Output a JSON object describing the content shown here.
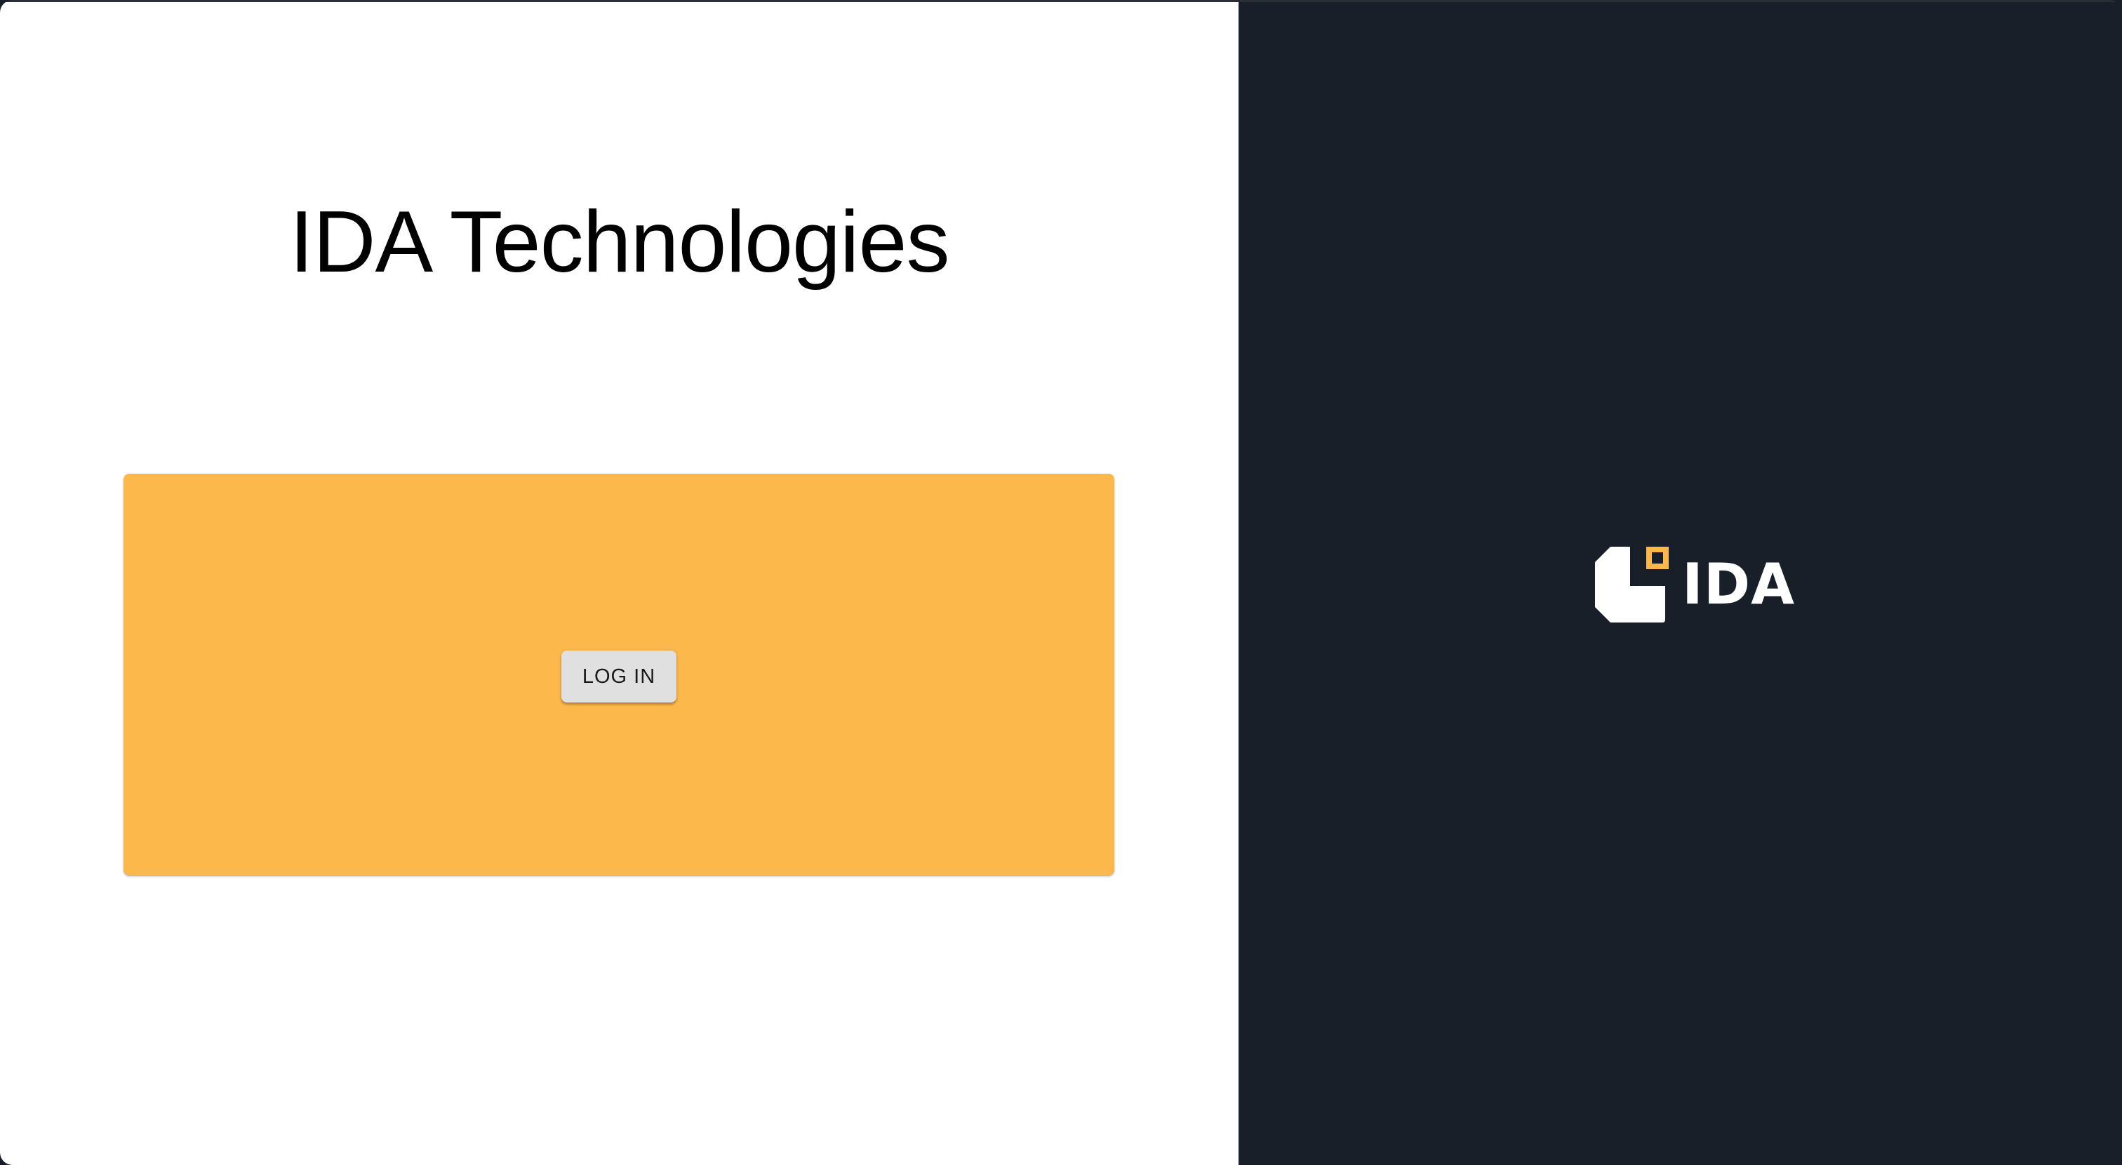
{
  "page": {
    "title": "IDA Technologies"
  },
  "login": {
    "button_label": "LOG IN"
  },
  "brand": {
    "logo_text": "IDA",
    "icon": "ida-logo-icon",
    "accent_color": "#fdb84b",
    "dark_background": "#181f29"
  }
}
